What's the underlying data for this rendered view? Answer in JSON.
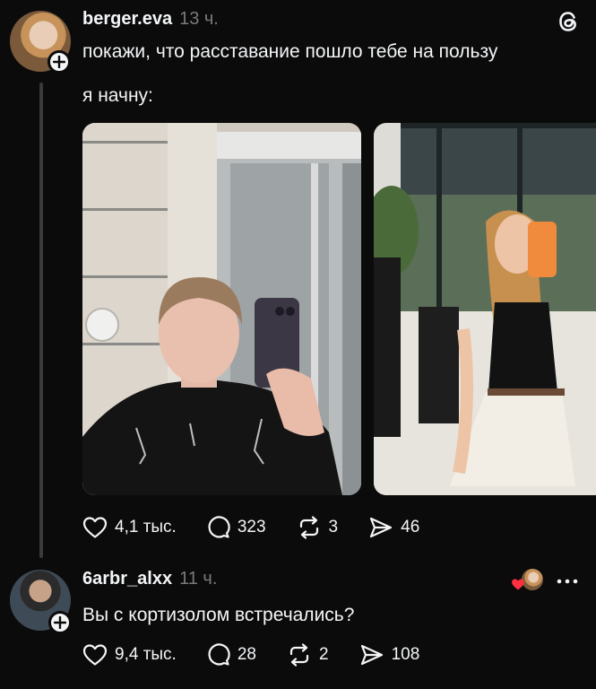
{
  "post": {
    "username": "berger.eva",
    "time": "13 ч.",
    "text": "покажи, что расставание пошло тебе на пользу",
    "text2": "я начну:",
    "actions": {
      "likes": "4,1 тыс.",
      "replies": "323",
      "reposts": "3",
      "shares": "46"
    },
    "images": [
      "mirror-selfie-before",
      "mirror-selfie-after"
    ]
  },
  "reply": {
    "username": "6arbr_alxx",
    "time": "11 ч.",
    "text": "Вы с кортизолом встречались?",
    "actions": {
      "likes": "9,4 тыс.",
      "replies": "28",
      "reposts": "2",
      "shares": "108"
    }
  },
  "icons": {
    "app": "threads-icon",
    "like": "heart-icon",
    "reply": "comment-icon",
    "repost": "repost-icon",
    "share": "send-icon",
    "more": "more-icon"
  },
  "colors": {
    "background": "#0b0b0b",
    "text": "#f3f5f7",
    "muted": "#7a7a7a",
    "liked": "#ff3040"
  }
}
